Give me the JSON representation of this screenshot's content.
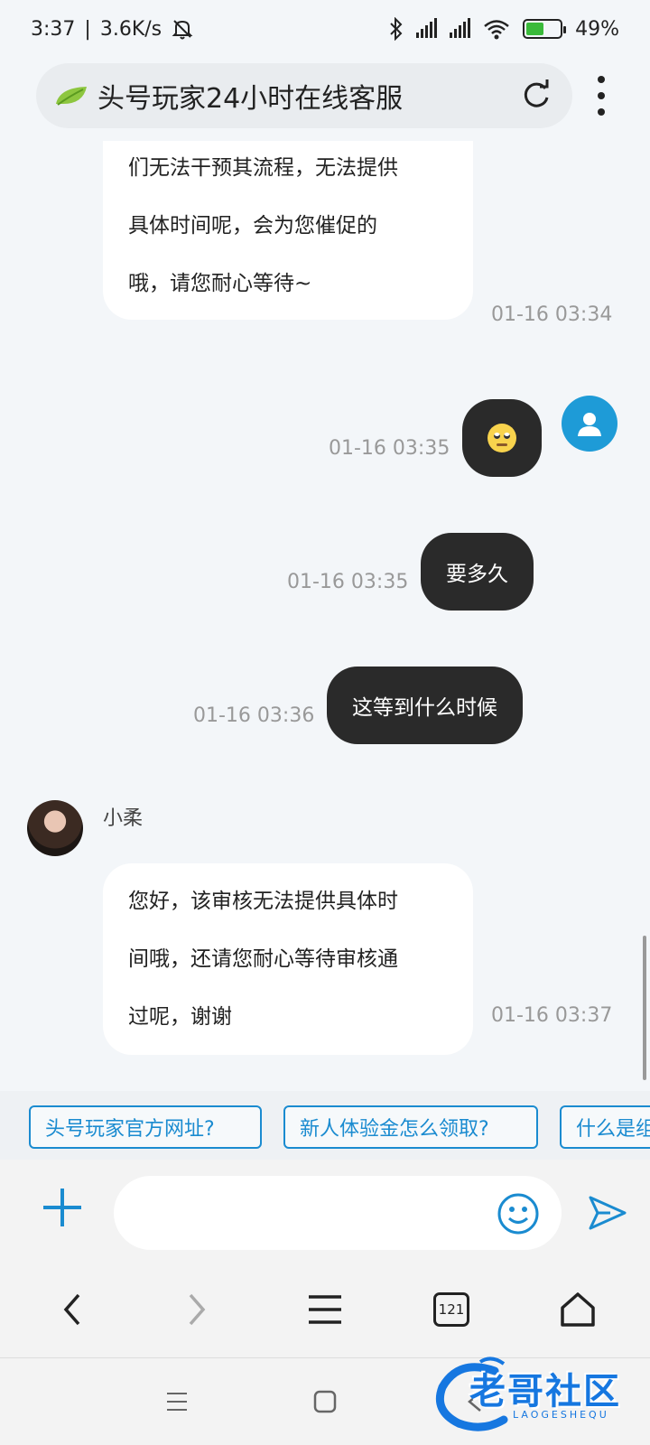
{
  "status_bar": {
    "time": "3:37",
    "speed": "3.6K/s",
    "battery": "49%",
    "icons": [
      "mute-icon",
      "bluetooth-icon",
      "signal-hd-icon",
      "signal-hd-icon",
      "wifi-icon",
      "battery-charging-icon"
    ]
  },
  "address_bar": {
    "title": "头号玩家24小时在线客服"
  },
  "chat": {
    "messages": [
      {
        "from": "agent",
        "lines": [
          "们无法干预其流程，无法提供",
          "具体时间呢，会为您催促的",
          "哦，请您耐心等待~"
        ],
        "time": "01-16 03:34"
      },
      {
        "from": "user",
        "emoji": "eye-roll-emoji",
        "time": "01-16 03:35"
      },
      {
        "from": "user",
        "text": "要多久",
        "time": "01-16 03:35"
      },
      {
        "from": "user",
        "text": "这等到什么时候",
        "time": "01-16 03:36"
      },
      {
        "from": "agent",
        "name": "小柔",
        "lines": [
          "您好，该审核无法提供具体时",
          "间哦，还请您耐心等待审核通",
          "过呢，谢谢"
        ],
        "time": "01-16 03:37"
      }
    ]
  },
  "quick_replies": [
    "头号玩家官方网址?",
    "新人体验金怎么领取?",
    "什么是组"
  ],
  "input": {
    "placeholder": ""
  },
  "browser_nav": {
    "tab_count": "121"
  },
  "watermark": {
    "title": "老哥社区",
    "subtitle": "LAOGESHEQU"
  }
}
